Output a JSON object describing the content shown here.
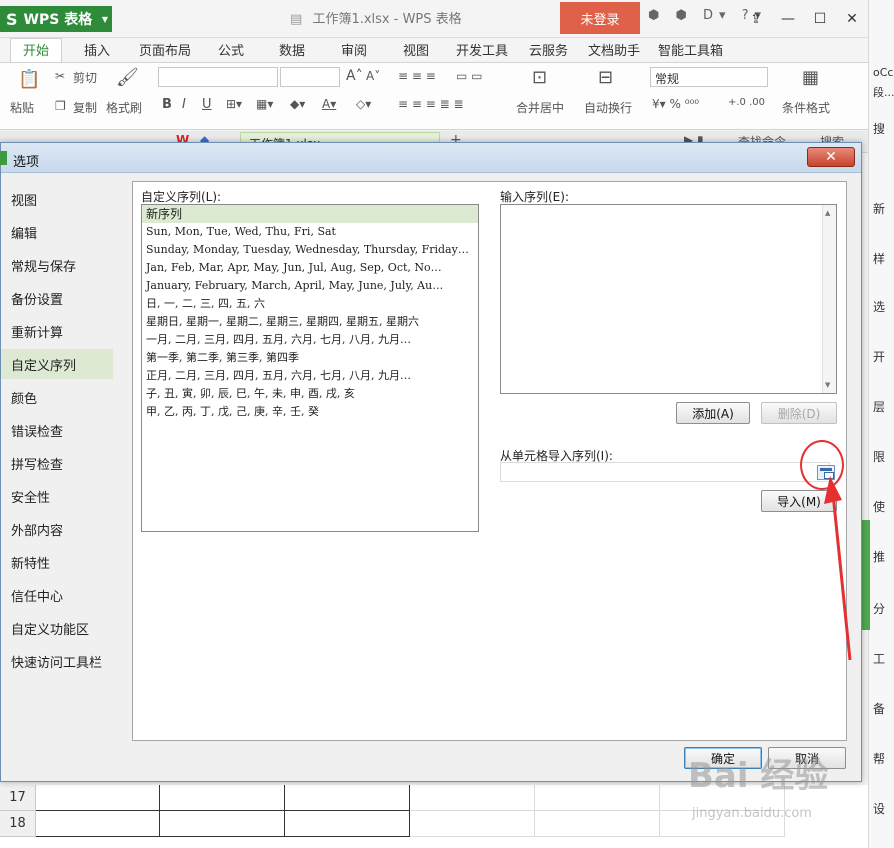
{
  "app": {
    "logo": "WPS 表格",
    "doc_title": "工作簿1.xlsx - WPS 表格",
    "login": "未登录",
    "title_icons": "⬢ ⬢ D▾ ?▾",
    "file_tab": "工作簿1.xlsx"
  },
  "ribbon": {
    "tabs": [
      "开始",
      "插入",
      "页面布局",
      "公式",
      "数据",
      "审阅",
      "视图",
      "开发工具",
      "云服务",
      "文档助手",
      "智能工具箱"
    ],
    "cut": "剪切",
    "paste": "粘贴",
    "copy": "复制",
    "format_painter": "格式刷",
    "merge_center": "合并居中",
    "wrap_text": "自动换行",
    "number_format": "常规",
    "conditional_format": "条件格式",
    "search_cmd": "查找命令",
    "search": "搜索"
  },
  "right_strip": [
    "oCcD",
    "段...",
    "搜",
    "新",
    "样",
    "选",
    "开",
    "层",
    "限",
    "使",
    "推",
    "分",
    "工",
    "备",
    "帮",
    "设"
  ],
  "sheet": {
    "rows": [
      "17",
      "18"
    ]
  },
  "dialog": {
    "title": "选项",
    "close": "✕",
    "nav": [
      "视图",
      "编辑",
      "常规与保存",
      "备份设置",
      "重新计算",
      "自定义序列",
      "颜色",
      "错误检查",
      "拼写检查",
      "安全性",
      "外部内容",
      "新特性",
      "信任中心",
      "自定义功能区",
      "快速访问工具栏"
    ],
    "active_nav": "自定义序列",
    "custom_list_label": "自定义序列(L):",
    "custom_lists": [
      "新序列",
      "Sun, Mon, Tue, Wed, Thu, Fri, Sat",
      "Sunday, Monday, Tuesday, Wednesday, Thursday, Friday…",
      "Jan, Feb, Mar, Apr, May, Jun, Jul, Aug, Sep, Oct, No…",
      "January, February, March, April, May, June, July, Au…",
      "日, 一, 二, 三, 四, 五, 六",
      "星期日, 星期一, 星期二, 星期三, 星期四, 星期五, 星期六",
      "一月, 二月, 三月, 四月, 五月, 六月, 七月, 八月, 九月…",
      "第一季, 第二季, 第三季, 第四季",
      "正月, 二月, 三月, 四月, 五月, 六月, 七月, 八月, 九月…",
      "子, 丑, 寅, 卯, 辰, 巳, 午, 未, 申, 酉, 戌, 亥",
      "甲, 乙, 丙, 丁, 戊, 己, 庚, 辛, 壬, 癸"
    ],
    "input_seq_label": "输入序列(E):",
    "add_button": "添加(A)",
    "delete_button": "删除(D)",
    "import_from_cells_label": "从单元格导入序列(I):",
    "import_button": "导入(M)",
    "ok_button": "确定",
    "cancel_button": "取消"
  },
  "watermark": {
    "main": "Bai 经验",
    "sub": "jingyan.baidu.com"
  },
  "colors": {
    "wps_green": "#2e8b3a",
    "login_red": "#e0614a",
    "selected_bg": "#dbead0",
    "annotation_red": "#e43030"
  }
}
